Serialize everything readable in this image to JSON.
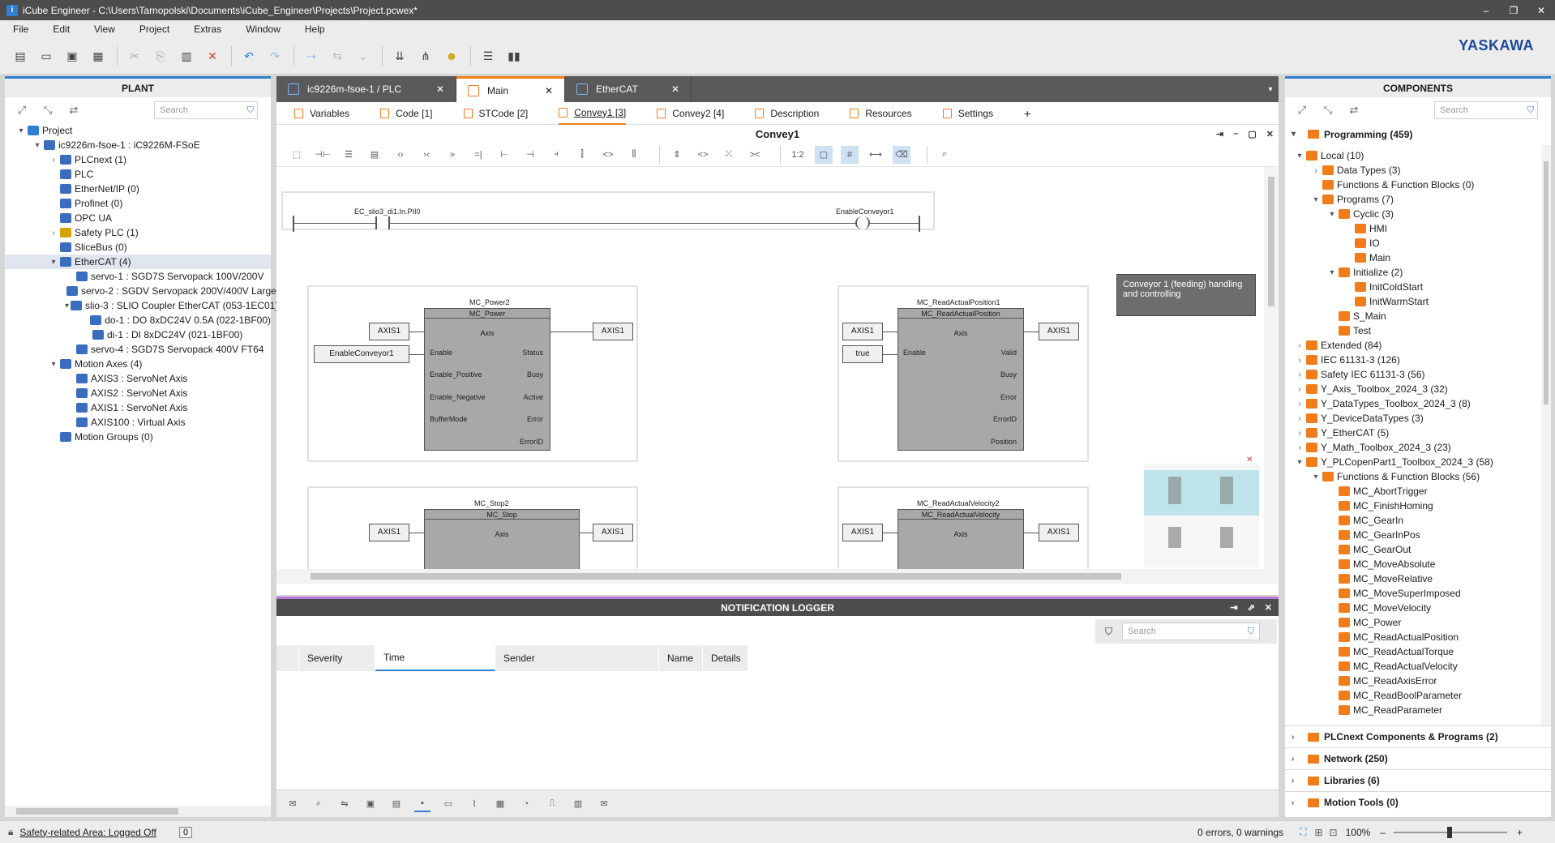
{
  "window": {
    "title": "iCube Engineer - C:\\Users\\Tarnopolski\\Documents\\iCube_Engineer\\Projects\\Project.pcwex*",
    "min": "–",
    "restore": "❐",
    "close": "✕"
  },
  "menu": [
    "File",
    "Edit",
    "View",
    "Project",
    "Extras",
    "Window",
    "Help"
  ],
  "brand": "YASKAWA",
  "plant": {
    "title": "PLANT",
    "search_placeholder": "Search",
    "tree": [
      {
        "label": "Project",
        "indent": 0,
        "arrow": "▾",
        "color": "#2e7fd0"
      },
      {
        "label": "ic9226m-fsoe-1 : iC9226M-FSoE",
        "indent": 1,
        "arrow": "▾",
        "color": "#3b6dbf"
      },
      {
        "label": "PLCnext (1)",
        "indent": 2,
        "arrow": "›",
        "color": "#3b6dbf"
      },
      {
        "label": "PLC",
        "indent": 2,
        "arrow": "",
        "color": "#3b6dbf"
      },
      {
        "label": "EtherNet/IP (0)",
        "indent": 2,
        "arrow": "",
        "color": "#3b6dbf"
      },
      {
        "label": "Profinet (0)",
        "indent": 2,
        "arrow": "",
        "color": "#3b6dbf"
      },
      {
        "label": "OPC UA",
        "indent": 2,
        "arrow": "",
        "color": "#3b6dbf"
      },
      {
        "label": "Safety PLC (1)",
        "indent": 2,
        "arrow": "›",
        "color": "#d4a300"
      },
      {
        "label": "SliceBus (0)",
        "indent": 2,
        "arrow": "",
        "color": "#3b6dbf"
      },
      {
        "label": "EtherCAT (4)",
        "indent": 2,
        "arrow": "▾",
        "color": "#3b6dbf"
      },
      {
        "label": "servo-1 : SGD7S Servopack 100V/200V",
        "indent": 3,
        "arrow": "",
        "color": "#3b6dbf"
      },
      {
        "label": "servo-2 : SGDV Servopack 200V/400V Large",
        "indent": 3,
        "arrow": "",
        "color": "#3b6dbf"
      },
      {
        "label": "slio-3 : SLIO Coupler EtherCAT (053-1EC01)",
        "indent": 3,
        "arrow": "▾",
        "color": "#3b6dbf"
      },
      {
        "label": "do-1 : DO 8xDC24V 0.5A (022-1BF00)",
        "indent": 4,
        "arrow": "",
        "color": "#3b6dbf"
      },
      {
        "label": "di-1 : DI 8xDC24V (021-1BF00)",
        "indent": 4,
        "arrow": "",
        "color": "#3b6dbf"
      },
      {
        "label": "servo-4 : SGD7S Servopack 400V FT64",
        "indent": 3,
        "arrow": "",
        "color": "#3b6dbf"
      },
      {
        "label": "Motion Axes (4)",
        "indent": 2,
        "arrow": "▾",
        "color": "#3b6dbf"
      },
      {
        "label": "AXIS3 : ServoNet Axis",
        "indent": 3,
        "arrow": "",
        "color": "#3b6dbf"
      },
      {
        "label": "AXIS2 : ServoNet Axis",
        "indent": 3,
        "arrow": "",
        "color": "#3b6dbf"
      },
      {
        "label": "AXIS1 : ServoNet Axis",
        "indent": 3,
        "arrow": "",
        "color": "#3b6dbf"
      },
      {
        "label": "AXIS100 : Virtual Axis",
        "indent": 3,
        "arrow": "",
        "color": "#3b6dbf"
      },
      {
        "label": "Motion Groups (0)",
        "indent": 2,
        "arrow": "",
        "color": "#3b6dbf"
      }
    ]
  },
  "doc_tabs": [
    {
      "label": "ic9226m-fsoe-1 / PLC",
      "active": false,
      "close": "✕"
    },
    {
      "label": "Main",
      "active": true,
      "close": "✕"
    },
    {
      "label": "EtherCAT",
      "active": false,
      "close": "✕"
    }
  ],
  "sub_tabs": [
    "Variables",
    "Code  [1]",
    "STCode  [2]",
    "Convey1  [3]",
    "Convey2  [4]",
    "Description",
    "Resources",
    "Settings"
  ],
  "active_subtab": "Convey1  [3]",
  "editor": {
    "title": "Convey1",
    "zoom_label": "1:2",
    "note": "Conveyor 1 (feeding) handling and controlling",
    "rung": {
      "contact_var": "EC_slio3_di1.In.PII0",
      "coil_var": "EnableConveyor1"
    },
    "blocks": [
      {
        "instance": "MC_Power2",
        "type": "MC_Power",
        "axis": "Axis",
        "in_axis": "AXIS1",
        "out_axis": "AXIS1",
        "inputs": [
          "Enable",
          "Enable_Positive",
          "Enable_Negative",
          "BufferMode"
        ],
        "outputs": [
          "Status",
          "Busy",
          "Active",
          "Error",
          "ErrorID"
        ],
        "in_enable": "EnableConveyor1"
      },
      {
        "instance": "MC_ReadActualPosition1",
        "type": "MC_ReadActualPosition",
        "axis": "Axis",
        "in_axis": "AXIS1",
        "out_axis": "AXIS1",
        "inputs": [
          "Enable"
        ],
        "outputs": [
          "Valid",
          "Busy",
          "Error",
          "ErrorID",
          "Position"
        ],
        "in_enable": "true"
      },
      {
        "instance": "MC_Stop2",
        "type": "MC_Stop",
        "axis": "Axis",
        "in_axis": "AXIS1",
        "out_axis": "AXIS1"
      },
      {
        "instance": "MC_ReadActualVelocity2",
        "type": "MC_ReadActualVelocity",
        "axis": "Axis",
        "in_axis": "AXIS1",
        "out_axis": "AXIS1"
      }
    ]
  },
  "logger": {
    "title": "NOTIFICATION LOGGER",
    "search_placeholder": "Search",
    "columns": [
      "Severity",
      "Time",
      "Sender",
      "Name",
      "Details"
    ]
  },
  "components": {
    "title": "COMPONENTS",
    "search_placeholder": "Search",
    "programming": "Programming (459)",
    "tree": [
      {
        "label": "Local (10)",
        "indent": 0,
        "arrow": "▾"
      },
      {
        "label": "Data Types (3)",
        "indent": 1,
        "arrow": "›"
      },
      {
        "label": "Functions & Function Blocks (0)",
        "indent": 1,
        "arrow": ""
      },
      {
        "label": "Programs (7)",
        "indent": 1,
        "arrow": "▾"
      },
      {
        "label": "Cyclic (3)",
        "indent": 2,
        "arrow": "▾"
      },
      {
        "label": "HMI",
        "indent": 3,
        "arrow": ""
      },
      {
        "label": "IO",
        "indent": 3,
        "arrow": ""
      },
      {
        "label": "Main",
        "indent": 3,
        "arrow": ""
      },
      {
        "label": "Initialize (2)",
        "indent": 2,
        "arrow": "▾"
      },
      {
        "label": "InitColdStart",
        "indent": 3,
        "arrow": ""
      },
      {
        "label": "InitWarmStart",
        "indent": 3,
        "arrow": ""
      },
      {
        "label": "S_Main",
        "indent": 2,
        "arrow": ""
      },
      {
        "label": "Test",
        "indent": 2,
        "arrow": ""
      },
      {
        "label": "Extended (84)",
        "indent": 0,
        "arrow": "›"
      },
      {
        "label": "IEC 61131-3 (126)",
        "indent": 0,
        "arrow": "›"
      },
      {
        "label": "Safety IEC 61131-3 (56)",
        "indent": 0,
        "arrow": "›"
      },
      {
        "label": "Y_Axis_Toolbox_2024_3 (32)",
        "indent": 0,
        "arrow": "›"
      },
      {
        "label": "Y_DataTypes_Toolbox_2024_3 (8)",
        "indent": 0,
        "arrow": "›"
      },
      {
        "label": "Y_DeviceDataTypes (3)",
        "indent": 0,
        "arrow": "›"
      },
      {
        "label": "Y_EtherCAT (5)",
        "indent": 0,
        "arrow": "›"
      },
      {
        "label": "Y_Math_Toolbox_2024_3 (23)",
        "indent": 0,
        "arrow": "›"
      },
      {
        "label": "Y_PLCopenPart1_Toolbox_2024_3 (58)",
        "indent": 0,
        "arrow": "▾"
      },
      {
        "label": "Functions & Function Blocks (56)",
        "indent": 1,
        "arrow": "▾"
      },
      {
        "label": "MC_AbortTrigger",
        "indent": 2,
        "arrow": ""
      },
      {
        "label": "MC_FinishHoming",
        "indent": 2,
        "arrow": ""
      },
      {
        "label": "MC_GearIn",
        "indent": 2,
        "arrow": ""
      },
      {
        "label": "MC_GearInPos",
        "indent": 2,
        "arrow": ""
      },
      {
        "label": "MC_GearOut",
        "indent": 2,
        "arrow": ""
      },
      {
        "label": "MC_MoveAbsolute",
        "indent": 2,
        "arrow": ""
      },
      {
        "label": "MC_MoveRelative",
        "indent": 2,
        "arrow": ""
      },
      {
        "label": "MC_MoveSuperImposed",
        "indent": 2,
        "arrow": ""
      },
      {
        "label": "MC_MoveVelocity",
        "indent": 2,
        "arrow": ""
      },
      {
        "label": "MC_Power",
        "indent": 2,
        "arrow": ""
      },
      {
        "label": "MC_ReadActualPosition",
        "indent": 2,
        "arrow": ""
      },
      {
        "label": "MC_ReadActualTorque",
        "indent": 2,
        "arrow": ""
      },
      {
        "label": "MC_ReadActualVelocity",
        "indent": 2,
        "arrow": ""
      },
      {
        "label": "MC_ReadAxisError",
        "indent": 2,
        "arrow": ""
      },
      {
        "label": "MC_ReadBoolParameter",
        "indent": 2,
        "arrow": ""
      },
      {
        "label": "MC_ReadParameter",
        "indent": 2,
        "arrow": ""
      }
    ],
    "sections": [
      "PLCnext Components & Programs (2)",
      "Network (250)",
      "Libraries (6)",
      "Motion Tools (0)"
    ]
  },
  "status": {
    "safety": "Safety-related Area: Logged Off",
    "counter": "0",
    "errors": "0 errors, 0 warnings",
    "zoom": "100%",
    "zoom_minus": "–",
    "zoom_plus": "+"
  },
  "colors": {
    "accent_orange": "#f07d1a",
    "accent_blue": "#2e7fd0",
    "logger_accent": "#b777d8",
    "brand_blue": "#1c4a9a"
  }
}
